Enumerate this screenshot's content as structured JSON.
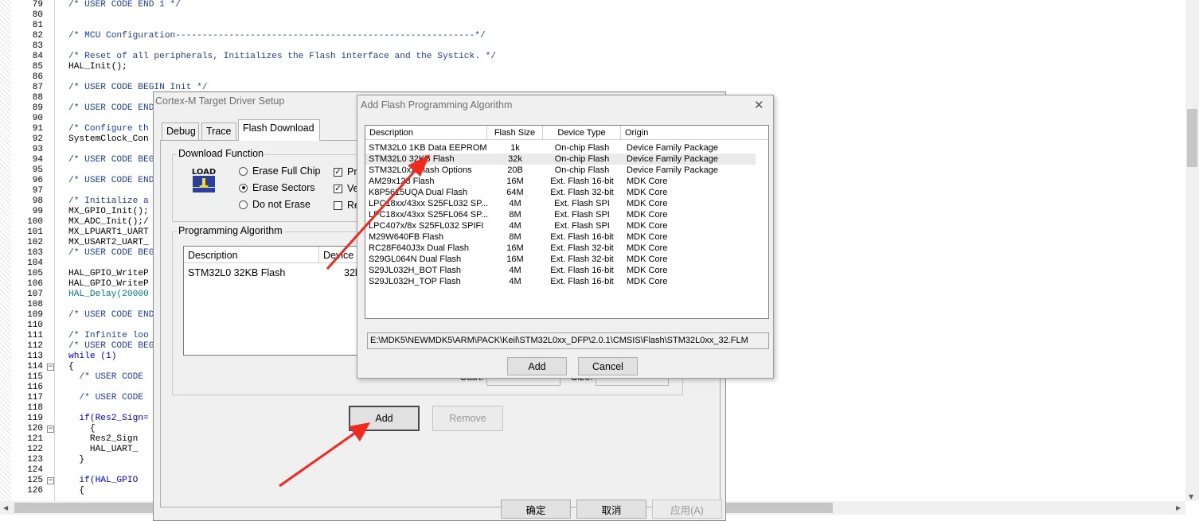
{
  "editor": {
    "line_numbers": [
      "79",
      "80",
      "81",
      "82",
      "83",
      "84",
      "85",
      "86",
      "87",
      "88",
      "89",
      "90",
      "91",
      "92",
      "93",
      "94",
      "95",
      "96",
      "97",
      "98",
      "99",
      "100",
      "101",
      "102",
      "103",
      "104",
      "105",
      "106",
      "107",
      "108",
      "109",
      "110",
      "111",
      "112",
      "113",
      "114",
      "115",
      "116",
      "117",
      "118",
      "119",
      "120",
      "121",
      "122",
      "123",
      "124",
      "125",
      "126"
    ],
    "lines": [
      {
        "t": "/* USER CODE END 1 */",
        "k": "com"
      },
      {
        "t": "",
        "k": ""
      },
      {
        "t": "",
        "k": ""
      },
      {
        "t": "/* MCU Configuration--------------------------------------------------------*/",
        "k": "com"
      },
      {
        "t": "",
        "k": ""
      },
      {
        "t": "/* Reset of all peripherals, Initializes the Flash interface and the Systick. */",
        "k": "com"
      },
      {
        "t": "HAL_Init();",
        "k": ""
      },
      {
        "t": "",
        "k": ""
      },
      {
        "t": "/* USER CODE BEGIN Init */",
        "k": "com"
      },
      {
        "t": "",
        "k": ""
      },
      {
        "t": "/* USER CODE END",
        "k": "com"
      },
      {
        "t": "",
        "k": ""
      },
      {
        "t": "/* Configure th",
        "k": "com"
      },
      {
        "t": "SystemClock_Con",
        "k": ""
      },
      {
        "t": "",
        "k": ""
      },
      {
        "t": "/* USER CODE BEG",
        "k": "com"
      },
      {
        "t": "",
        "k": ""
      },
      {
        "t": "/* USER CODE END",
        "k": "com"
      },
      {
        "t": "",
        "k": ""
      },
      {
        "t": "/* Initialize a",
        "k": "com"
      },
      {
        "t": "MX_GPIO_Init();",
        "k": ""
      },
      {
        "t": "MX_ADC_Init();/",
        "k": ""
      },
      {
        "t": "MX_LPUART1_UART",
        "k": ""
      },
      {
        "t": "MX_USART2_UART_",
        "k": ""
      },
      {
        "t": "/* USER CODE BEG",
        "k": "com"
      },
      {
        "t": "",
        "k": ""
      },
      {
        "t": "HAL_GPIO_WriteP",
        "k": ""
      },
      {
        "t": "HAL_GPIO_WriteP",
        "k": ""
      },
      {
        "t": "HAL_Delay(20000",
        "k": "num"
      },
      {
        "t": "",
        "k": ""
      },
      {
        "t": "/* USER CODE END",
        "k": "com"
      },
      {
        "t": "",
        "k": ""
      },
      {
        "t": "/* Infinite loo",
        "k": "com"
      },
      {
        "t": "/* USER CODE BEG",
        "k": "com"
      },
      {
        "t": "while (1)",
        "k": "kw"
      },
      {
        "t": "{",
        "k": ""
      },
      {
        "t": "  /* USER CODE",
        "k": "com"
      },
      {
        "t": "",
        "k": ""
      },
      {
        "t": "  /* USER CODE",
        "k": "com"
      },
      {
        "t": "",
        "k": ""
      },
      {
        "t": "  if(Res2_Sign=",
        "k": "kw"
      },
      {
        "t": "    {",
        "k": ""
      },
      {
        "t": "    Res2_Sign",
        "k": ""
      },
      {
        "t": "    HAL_UART_",
        "k": ""
      },
      {
        "t": "  }",
        "k": ""
      },
      {
        "t": "",
        "k": ""
      },
      {
        "t": "  if(HAL_GPIO",
        "k": "kw"
      },
      {
        "t": "  {",
        "k": ""
      }
    ]
  },
  "cortex_dialog": {
    "title": "Cortex-M Target Driver Setup",
    "tabs": [
      "Debug",
      "Trace",
      "Flash Download"
    ],
    "download_function": {
      "title": "Download Function",
      "icon_label": "LOAD",
      "radios": [
        {
          "label": "Erase Full Chip",
          "checked": false
        },
        {
          "label": "Erase Sectors",
          "checked": true
        },
        {
          "label": "Do not Erase",
          "checked": false
        }
      ],
      "checks": [
        {
          "label": "Pr",
          "checked": true
        },
        {
          "label": "Ve",
          "checked": true
        },
        {
          "label": "Re",
          "checked": false
        }
      ]
    },
    "programming_algorithm": {
      "title": "Programming Algorithm",
      "columns": [
        "Description",
        "Device"
      ],
      "rows": [
        {
          "description": "STM32L0 32KB Flash",
          "device": "32k"
        }
      ],
      "start_label": "Start:",
      "size_label": "Size:"
    },
    "add_button": "Add",
    "remove_button": "Remove",
    "ok_button": "确定",
    "cancel_button": "取消",
    "apply_button": "应用(A)"
  },
  "add_flash_dialog": {
    "title": "Add Flash Programming Algorithm",
    "close": "✕",
    "columns": [
      "Description",
      "Flash Size",
      "Device Type",
      "Origin"
    ],
    "rows": [
      {
        "description": "STM32L0 1KB Data EEPROM",
        "size": "1k",
        "type": "On-chip Flash",
        "origin": "Device Family Package",
        "selected": false
      },
      {
        "description": "STM32L0 32KB Flash",
        "size": "32k",
        "type": "On-chip Flash",
        "origin": "Device Family Package",
        "selected": true
      },
      {
        "description": "STM32L0xx Flash Options",
        "size": "20B",
        "type": "On-chip Flash",
        "origin": "Device Family Package",
        "selected": false
      },
      {
        "description": "AM29x128 Flash",
        "size": "16M",
        "type": "Ext. Flash 16-bit",
        "origin": "MDK Core",
        "selected": false
      },
      {
        "description": "K8P5615UQA Dual Flash",
        "size": "64M",
        "type": "Ext. Flash 32-bit",
        "origin": "MDK Core",
        "selected": false
      },
      {
        "description": "LPC18xx/43xx S25FL032 SP...",
        "size": "4M",
        "type": "Ext. Flash SPI",
        "origin": "MDK Core",
        "selected": false
      },
      {
        "description": "LPC18xx/43xx S25FL064 SP...",
        "size": "8M",
        "type": "Ext. Flash SPI",
        "origin": "MDK Core",
        "selected": false
      },
      {
        "description": "LPC407x/8x S25FL032 SPIFI",
        "size": "4M",
        "type": "Ext. Flash SPI",
        "origin": "MDK Core",
        "selected": false
      },
      {
        "description": "M29W640FB Flash",
        "size": "8M",
        "type": "Ext. Flash 16-bit",
        "origin": "MDK Core",
        "selected": false
      },
      {
        "description": "RC28F640J3x Dual Flash",
        "size": "16M",
        "type": "Ext. Flash 32-bit",
        "origin": "MDK Core",
        "selected": false
      },
      {
        "description": "S29GL064N Dual Flash",
        "size": "16M",
        "type": "Ext. Flash 32-bit",
        "origin": "MDK Core",
        "selected": false
      },
      {
        "description": "S29JL032H_BOT Flash",
        "size": "4M",
        "type": "Ext. Flash 16-bit",
        "origin": "MDK Core",
        "selected": false
      },
      {
        "description": "S29JL032H_TOP Flash",
        "size": "4M",
        "type": "Ext. Flash 16-bit",
        "origin": "MDK Core",
        "selected": false
      }
    ],
    "path": "E:\\MDK5\\NEWMDK5\\ARM\\PACK\\Keil\\STM32L0xx_DFP\\2.0.1\\CMSIS\\Flash\\STM32L0xx_32.FLM",
    "add_button": "Add",
    "cancel_button": "Cancel"
  },
  "colors": {
    "annotation_arrow": "#f02a1e",
    "comment": "#1f3fa0",
    "keyword": "#0000cc"
  }
}
